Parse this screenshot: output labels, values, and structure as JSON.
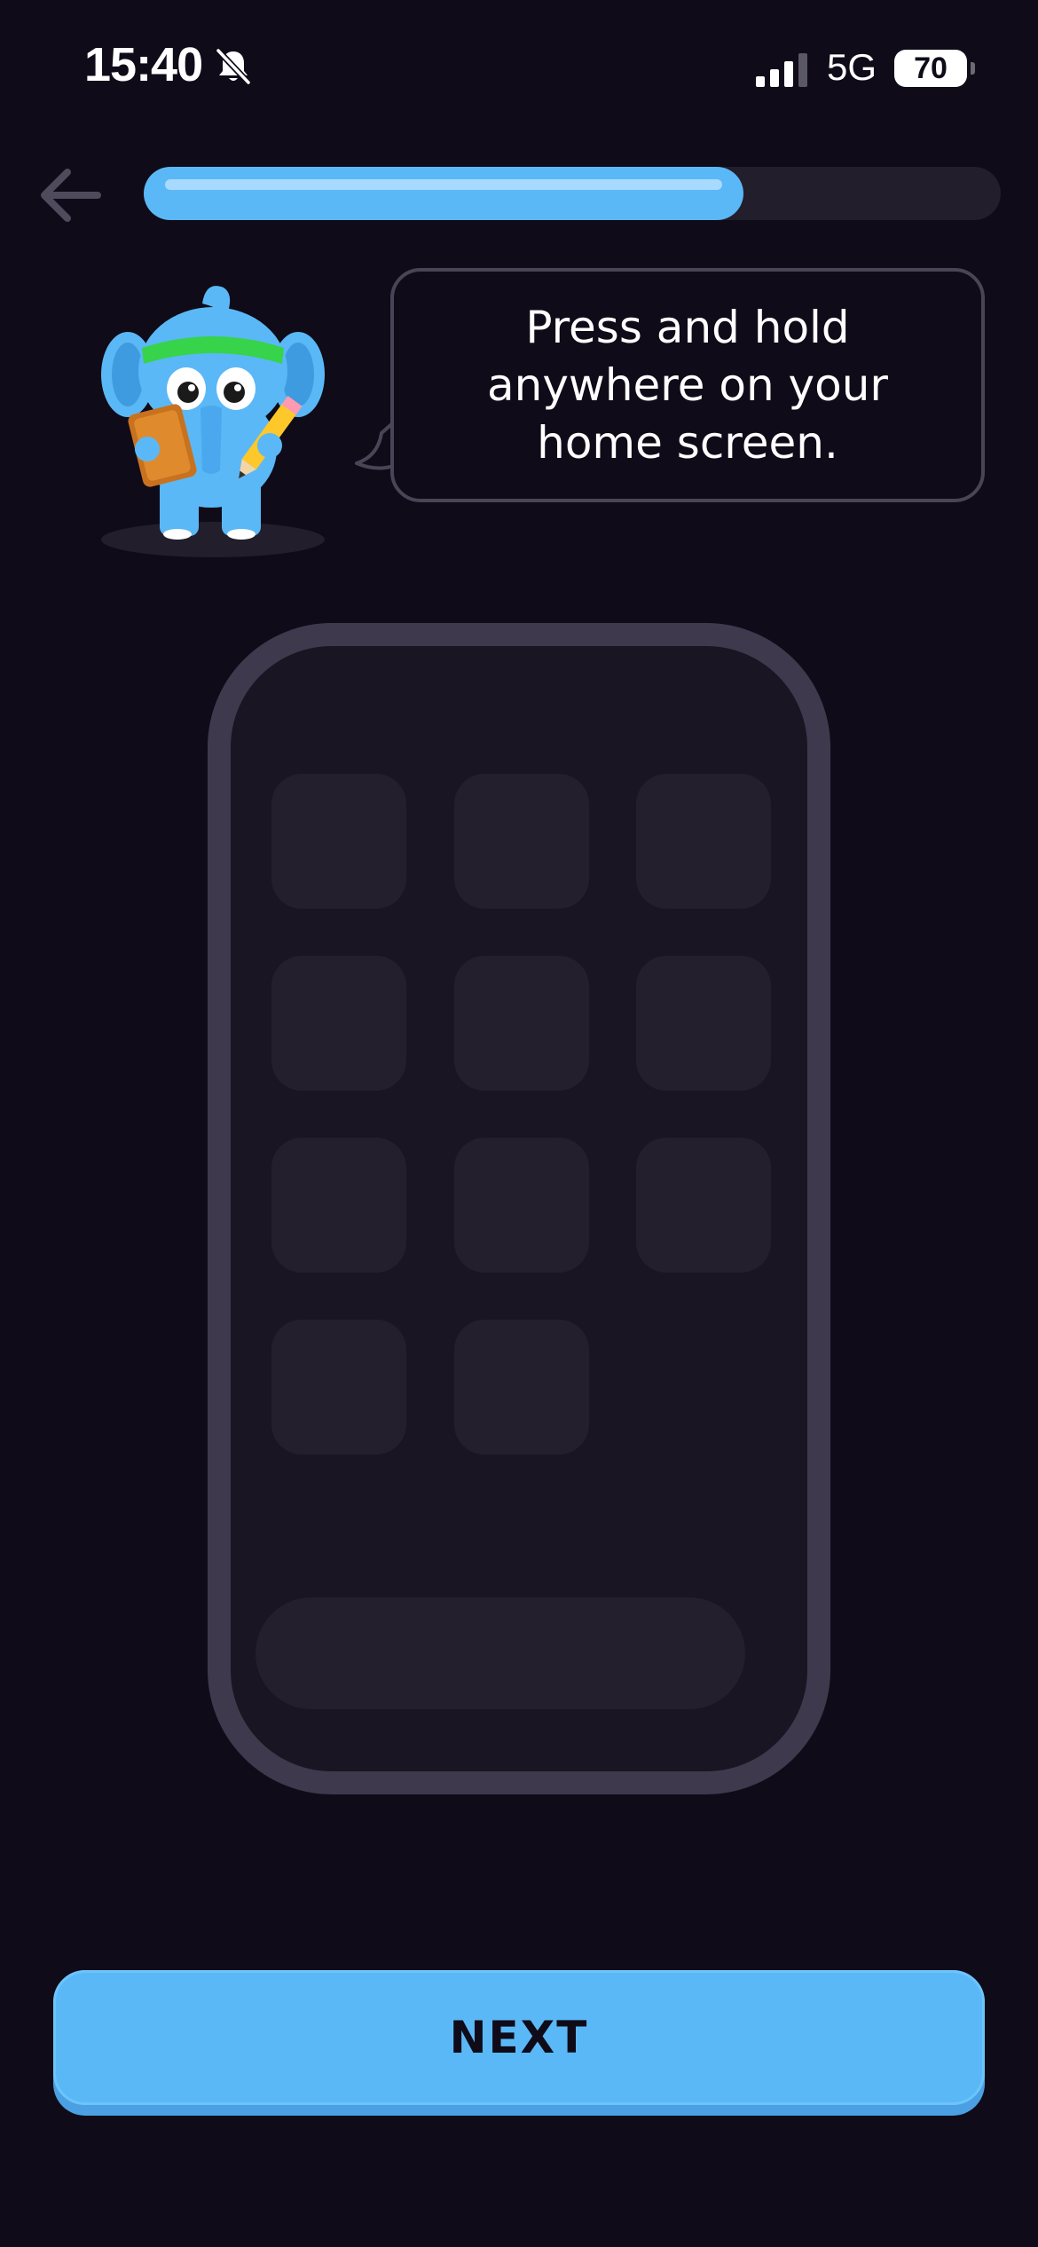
{
  "status_bar": {
    "time": "15:40",
    "silent_icon": "bell-slash-icon",
    "signal_icon": "cellular-signal-icon",
    "network": "5G",
    "battery": "70"
  },
  "header": {
    "back_icon": "arrow-left-icon",
    "progress": 0.7
  },
  "tutorial": {
    "mascot": "elephant-mascot",
    "message": "Press and hold anywhere on your home screen."
  },
  "illustration": {
    "type": "phone-home-screen",
    "app_icon_count": 11,
    "has_dock": true
  },
  "footer": {
    "next_label": "NEXT"
  },
  "colors": {
    "background": "#0f0b18",
    "accent": "#5bb8f6",
    "accent_shadow": "#4aa0e2",
    "phone_frame": "#3e394d",
    "phone_screen": "#191522",
    "tile": "#231f2d"
  }
}
